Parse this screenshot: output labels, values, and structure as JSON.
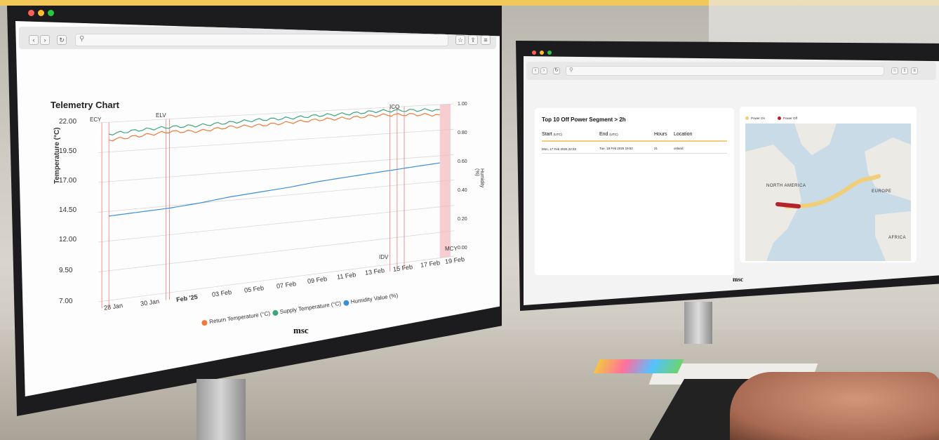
{
  "left_screen": {
    "browser": {
      "search_icon": "search-icon",
      "nav": [
        "‹",
        "›"
      ],
      "reload": "↻"
    },
    "chart_title": "Telemetry Chart",
    "markers": [
      "ECY",
      "ELV",
      "ICO",
      "IDV",
      "MCY"
    ],
    "brand": "msc",
    "chart_data": {
      "type": "line",
      "title": "Telemetry Chart",
      "ylabel": "Temperature (°C)",
      "y2label": "Humidity (%)",
      "ylim": [
        7.0,
        22.0
      ],
      "y2lim": [
        0.0,
        1.0
      ],
      "yticks": [
        "22.00",
        "19.50",
        "17.00",
        "14.50",
        "12.00",
        "9.50",
        "7.00"
      ],
      "y2ticks": [
        "1.00",
        "0.80",
        "0.60",
        "0.40",
        "0.20",
        "0.00"
      ],
      "xticks": [
        "28 Jan",
        "30 Jan",
        "Feb '25",
        "03 Feb",
        "05 Feb",
        "07 Feb",
        "09 Feb",
        "11 Feb",
        "13 Feb",
        "15 Feb",
        "17 Feb",
        "19 Feb"
      ],
      "legend_position": "bottom",
      "series": [
        {
          "name": "Return Temperature (°C)",
          "color": "#f07a3a",
          "values": [
            20.5,
            20.7,
            20.9,
            20.8,
            21.0,
            21.0,
            21.1,
            21.2,
            21.2,
            21.3,
            21.2,
            21.0
          ]
        },
        {
          "name": "Supply Temperature (°C)",
          "color": "#3aa67c",
          "values": [
            21.0,
            21.2,
            21.3,
            21.3,
            21.4,
            21.5,
            21.5,
            21.6,
            21.6,
            21.7,
            21.6,
            21.5
          ]
        },
        {
          "name": "Humidity Value (%)",
          "color": "#3b8fd9",
          "values": [
            14.1,
            14.2,
            14.3,
            14.5,
            14.8,
            15.0,
            15.2,
            15.5,
            15.7,
            15.9,
            16.1,
            16.3
          ]
        }
      ]
    }
  },
  "right_screen": {
    "table": {
      "title": "Top 10 Off Power Segment > 2h",
      "headers": [
        {
          "label": "Start",
          "unit": "(UTC)"
        },
        {
          "label": "End",
          "unit": "(UTC)"
        },
        {
          "label": "Hours",
          "unit": ""
        },
        {
          "label": "Location",
          "unit": ""
        }
      ],
      "rows": [
        [
          "Mon, 17 Feb 2025 22:33",
          "Tue, 18 Feb 2025 19:52",
          "21",
          "onland"
        ]
      ]
    },
    "map": {
      "legend": [
        {
          "label": "Power On",
          "color": "#f1cf7a"
        },
        {
          "label": "Power Off",
          "color": "#b3232e"
        }
      ],
      "labels": [
        "NORTH AMERICA",
        "EUROPE",
        "AFRICA"
      ]
    },
    "brand": "msc"
  },
  "colors": {
    "accent_band": "#f2c85a",
    "window_red": "#ff5f57",
    "window_yellow": "#febc2e",
    "window_green": "#28c840"
  }
}
